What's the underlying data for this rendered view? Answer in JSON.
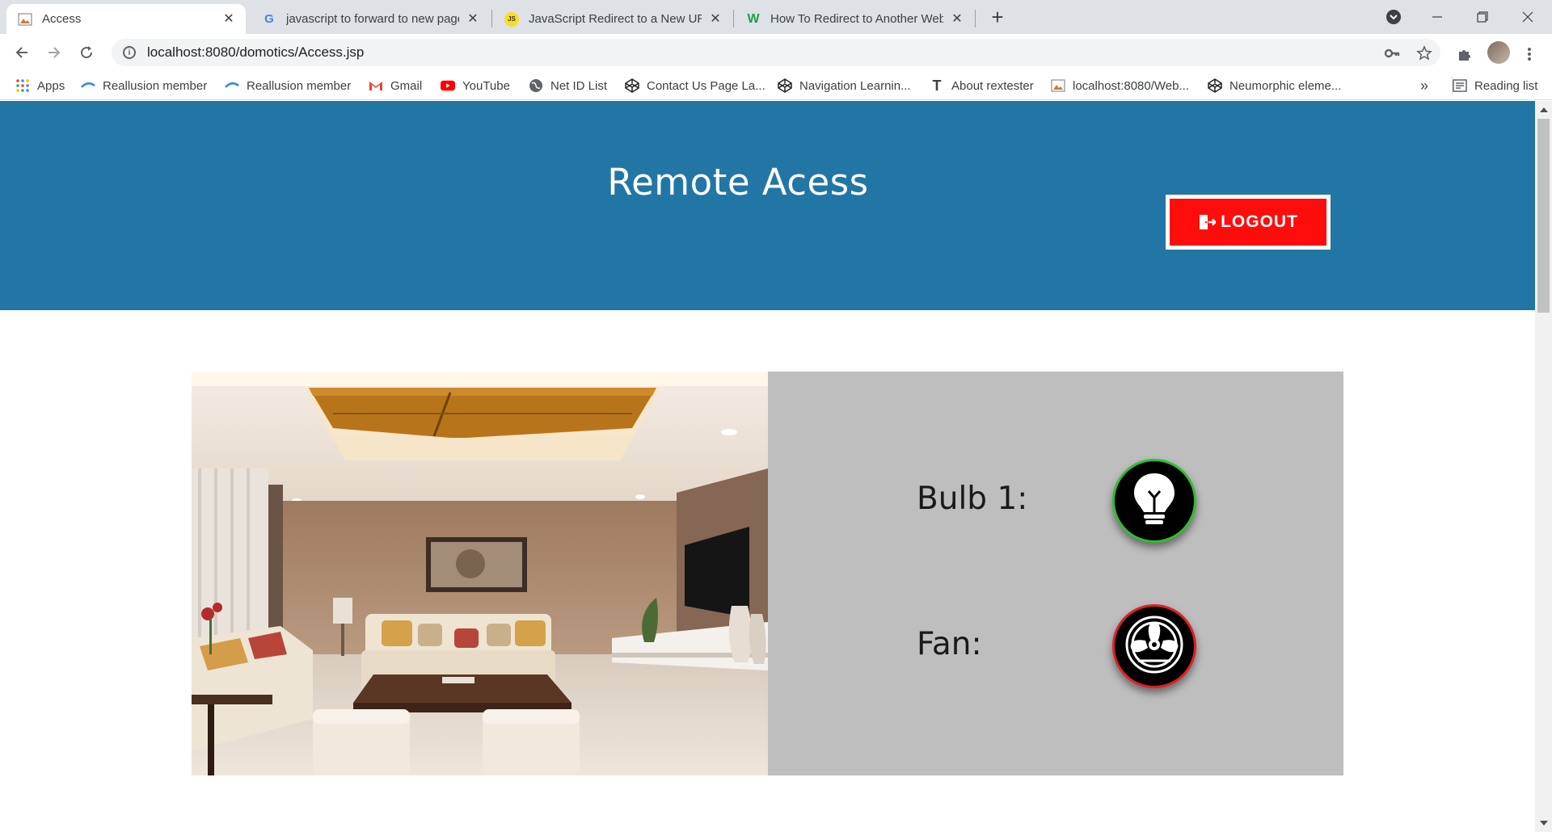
{
  "browser": {
    "tabs": [
      {
        "title": "Access",
        "active": true
      },
      {
        "title": "javascript to forward to new page",
        "active": false
      },
      {
        "title": "JavaScript Redirect to a New URL",
        "active": false
      },
      {
        "title": "How To Redirect to Another Web",
        "active": false
      }
    ],
    "favicon_js": "JS",
    "favicon_w": "W",
    "favicon_g": "G",
    "url": "localhost:8080/domotics/Access.jsp",
    "bookmarks": [
      {
        "label": "Apps",
        "icon": "apps-grid-icon"
      },
      {
        "label": "Reallusion member",
        "icon": "reallusion-icon"
      },
      {
        "label": "Reallusion member",
        "icon": "reallusion-icon"
      },
      {
        "label": "Gmail",
        "icon": "gmail-icon"
      },
      {
        "label": "YouTube",
        "icon": "youtube-icon"
      },
      {
        "label": "Net ID List",
        "icon": "globe-icon"
      },
      {
        "label": "Contact Us Page La...",
        "icon": "codepen-icon"
      },
      {
        "label": "Navigation Learnin...",
        "icon": "codepen-icon"
      },
      {
        "label": "About rextester",
        "icon": "text-t-icon"
      },
      {
        "label": "localhost:8080/Web...",
        "icon": "image-file-icon"
      },
      {
        "label": "Neumorphic eleme...",
        "icon": "codepen-icon"
      }
    ],
    "bookmark_t_glyph": "T",
    "more_bookmarks": "»",
    "reading_list": "Reading list"
  },
  "page": {
    "title": "Remote Acess",
    "logout_label": "LOGOUT",
    "devices": [
      {
        "label": "Bulb 1:",
        "icon": "lightbulb-icon",
        "state": "on",
        "ring_color": "#2fbf2f"
      },
      {
        "label": "Fan:",
        "icon": "fan-icon",
        "state": "off",
        "ring_color": "#e02020"
      }
    ]
  },
  "colors": {
    "header": "#2276a5",
    "logout": "#ff0d0d",
    "control_panel": "#bebebe"
  }
}
